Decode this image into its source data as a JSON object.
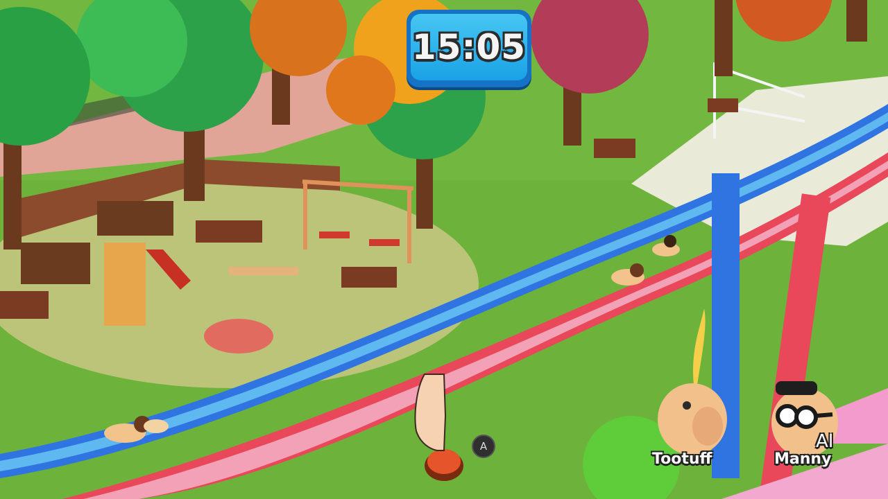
{
  "hud": {
    "timer": "15:05"
  },
  "prompt": {
    "button": "A",
    "icon": "finger-press-icon"
  },
  "players": [
    {
      "name": "Tootuff",
      "tag": ""
    },
    {
      "name": "Manny",
      "tag": "AI"
    }
  ],
  "colors": {
    "timer_bg": "#1aa2e6",
    "slide_blue": "#2f74e0",
    "slide_red": "#e8485a",
    "grass": "#6fb73a"
  }
}
